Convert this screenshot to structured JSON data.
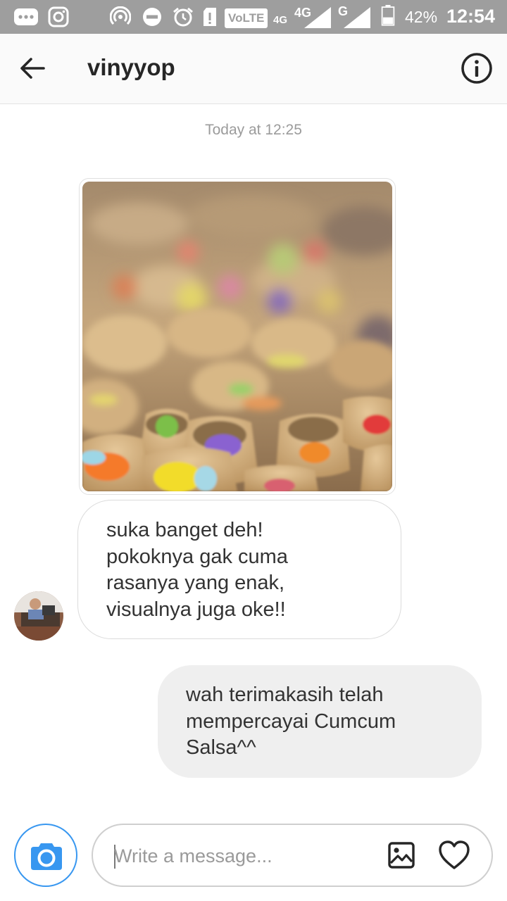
{
  "status_bar": {
    "icons": [
      "messages-icon",
      "instagram-icon",
      "hotspot-icon",
      "do-not-disturb-icon",
      "alarm-icon",
      "sd-card-alert-icon",
      "volte-badge",
      "signal-4g-icon",
      "signal-g-icon",
      "battery-icon"
    ],
    "volte_label": "VoLTE",
    "network_4g_label": "4G",
    "network_g_label": "G",
    "battery_percent": "42%",
    "time": "12:54"
  },
  "header": {
    "back_icon": "arrow-left-icon",
    "username": "vinyyop",
    "info_icon": "info-icon"
  },
  "conversation": {
    "timestamp": "Today at 12:25",
    "messages": [
      {
        "type": "photo",
        "direction": "incoming",
        "description_icon": "photo-cookies"
      },
      {
        "type": "text",
        "direction": "incoming",
        "lines": [
          "suka banget deh!",
          "pokoknya gak cuma",
          "rasanya yang enak,",
          "visualnya juga oke!!"
        ]
      },
      {
        "type": "text",
        "direction": "outgoing",
        "lines": [
          "wah terimakasih telah",
          "mempercayai Cumcum",
          "Salsa^^"
        ]
      }
    ]
  },
  "composer": {
    "camera_icon": "camera-icon",
    "placeholder": "Write a message...",
    "gallery_icon": "gallery-icon",
    "like_icon": "heart-icon"
  },
  "colors": {
    "status_bar_bg": "#9e9e9e",
    "header_bg": "#fafafa",
    "accent_blue": "#3897f0",
    "outgoing_bubble_bg": "#efefef",
    "incoming_bubble_border": "#dbdbdb"
  }
}
